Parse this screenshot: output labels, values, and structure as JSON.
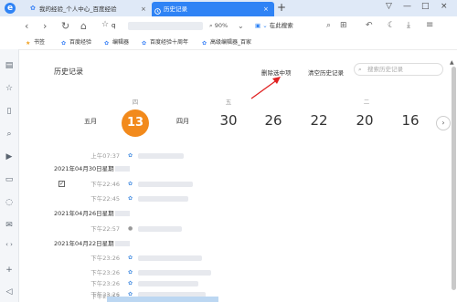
{
  "browser": {
    "tabs": [
      {
        "label": "我的经验_个人中心_百度经验",
        "active": false,
        "close": "×"
      },
      {
        "label": "历史记录",
        "active": true,
        "close": "×"
      }
    ],
    "new_tab": "+",
    "window_controls": [
      "▽",
      "—",
      "□",
      "×"
    ],
    "address": {
      "text": "q",
      "zoom": "90%"
    },
    "search": {
      "placeholder": "在此搜索"
    },
    "nav_icons": [
      "back-icon",
      "forward-icon",
      "reload-icon",
      "home-icon",
      "star-icon"
    ]
  },
  "bookmarks": [
    {
      "label": "书签",
      "icon": "★"
    },
    {
      "label": "百度经验",
      "icon": "✿"
    },
    {
      "label": "编辑器",
      "icon": "✿"
    },
    {
      "label": "百度经验十周年",
      "icon": "✿"
    },
    {
      "label": "高级编辑器_百家",
      "icon": "✿"
    }
  ],
  "history": {
    "title": "历史记录",
    "delete_selected": "删除选中项",
    "clear_history": "清空历史记录",
    "search_placeholder": "搜索历史记录",
    "calendar": [
      {
        "weekday": "",
        "day": "五月"
      },
      {
        "weekday": "四",
        "day": "13",
        "today": true
      },
      {
        "weekday": "",
        "day": "四月"
      },
      {
        "weekday": "五",
        "day": "30"
      },
      {
        "weekday": "",
        "day": "26"
      },
      {
        "weekday": "",
        "day": "22"
      },
      {
        "weekday": "二",
        "day": "20"
      },
      {
        "weekday": "",
        "day": "16"
      }
    ],
    "rows": [
      {
        "type": "item",
        "time": "上午07:37"
      },
      {
        "type": "date",
        "label": "2021年04月30日星期"
      },
      {
        "type": "item",
        "time": "下午22:46",
        "checked": true
      },
      {
        "type": "item",
        "time": "下午22:45"
      },
      {
        "type": "date",
        "label": "2021年04月26日星期"
      },
      {
        "type": "item",
        "time": "下午22:57"
      },
      {
        "type": "date",
        "label": "2021年04月22日星期"
      },
      {
        "type": "item",
        "time": "下午23:26"
      },
      {
        "type": "item",
        "time": "下午23:26"
      },
      {
        "type": "item",
        "time": "下午23:26"
      },
      {
        "type": "item",
        "time": "下午23:26"
      },
      {
        "type": "item",
        "time": "下午22:53"
      }
    ]
  },
  "colors": {
    "accent": "#2f83f5",
    "today": "#f28a1c",
    "annotation_arrow": "#e02020"
  }
}
